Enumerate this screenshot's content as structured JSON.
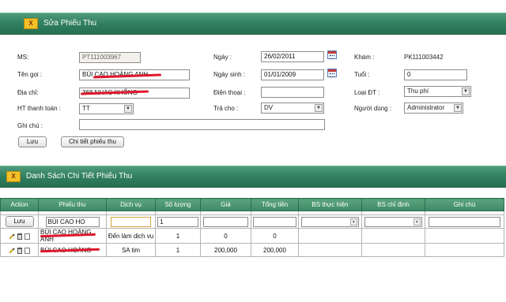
{
  "edit_section": {
    "icon_label": "X",
    "title": "Sửa Phiếu Thu"
  },
  "form": {
    "ms_label": "MS:",
    "ms_value": "PT111003967",
    "ten_goi_label": "Tên gọi :",
    "ten_goi_value": "BÙI CAO HOÀNG ANH",
    "dia_chi_label": "Địa chỉ:",
    "dia_chi_value": "368 NHẠC KHÔNG",
    "ht_thanh_toan_label": "HT thanh toán :",
    "ht_thanh_toan_value": "TT",
    "ghi_chu_label": "Ghi chú :",
    "ghi_chu_value": "",
    "ngay_label": "Ngày :",
    "ngay_value": "26/02/2011",
    "ngay_sinh_label": "Ngày sinh :",
    "ngay_sinh_value": "01/01/2009",
    "dien_thoai_label": "Điện thoại :",
    "dien_thoai_value": "",
    "tra_cho_label": "Trả cho :",
    "tra_cho_value": "DV",
    "kham_label": "Khám :",
    "kham_value": "PK111003442",
    "tuoi_label": "Tuổi :",
    "tuoi_value": "0",
    "loai_dt_label": "Loại ĐT :",
    "loai_dt_value": "Thu phí",
    "nguoi_dung_label": "Người dùng :",
    "nguoi_dung_value": "Administrator",
    "luu_button": "Lưu",
    "chi_tiet_button": "Chi tiết phiếu thu"
  },
  "detail_section": {
    "icon_label": "X",
    "title": "Danh Sách Chi Tiết Phiếu Thu"
  },
  "table": {
    "headers": [
      "Action",
      "Phiếu thu",
      "Dịch vụ",
      "Số lượng",
      "Giá",
      "Tổng tiền",
      "BS thực hiện",
      "BS chỉ định",
      "Ghi chú"
    ],
    "edit_row": {
      "luu_button": "Lưu",
      "phieu_thu": "BÙI CAO HO",
      "so_luong": "1"
    },
    "rows": [
      {
        "phieu_thu": "BÙI CAO HOÀNG ANH",
        "dich_vu": "Đến làm dịch vụ",
        "so_luong": "1",
        "gia": "0",
        "tong_tien": "0"
      },
      {
        "phieu_thu": "BÙI CAO HOÀNG",
        "dich_vu": "SA tim",
        "so_luong": "1",
        "gia": "200,000",
        "tong_tien": "200,000"
      }
    ]
  }
}
